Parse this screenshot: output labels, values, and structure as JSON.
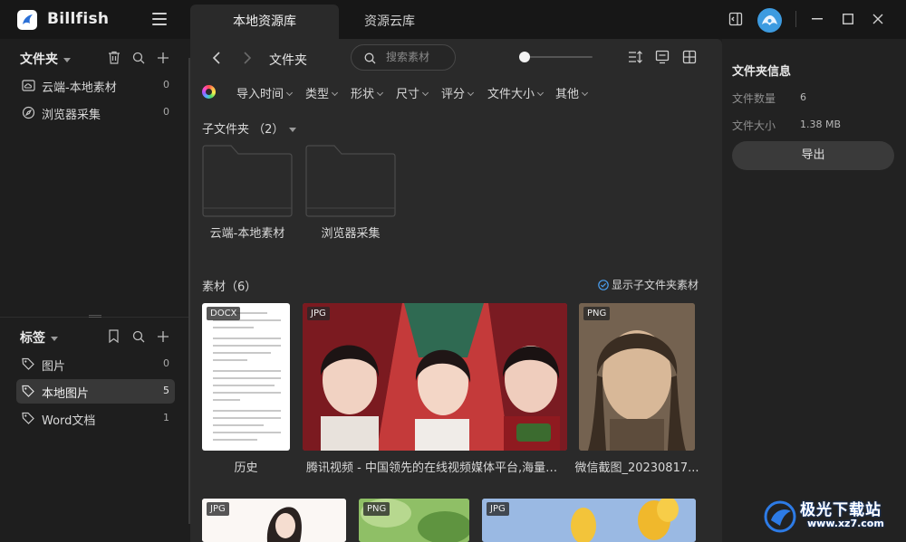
{
  "app": {
    "name": "Billfish"
  },
  "tabs": [
    {
      "label": "本地资源库",
      "active": true
    },
    {
      "label": "资源云库",
      "active": false
    }
  ],
  "sidebar": {
    "folders_title": "文件夹",
    "folders": [
      {
        "label": "云端-本地素材",
        "count": "0",
        "icon": "cloud-icon"
      },
      {
        "label": "浏览器采集",
        "count": "0",
        "icon": "compass-icon"
      }
    ],
    "tags_title": "标签",
    "tags": [
      {
        "label": "图片",
        "count": "0",
        "active": false
      },
      {
        "label": "本地图片",
        "count": "5",
        "active": true
      },
      {
        "label": "Word文档",
        "count": "1",
        "active": false
      }
    ]
  },
  "toolbar": {
    "crumb": "文件夹",
    "search_placeholder": "搜索素材",
    "thumb_size": 0.0
  },
  "filters": [
    "导入时间",
    "类型",
    "形状",
    "尺寸",
    "评分",
    "文件大小",
    "其他"
  ],
  "subfolders": {
    "title": "子文件夹 （2）",
    "items": [
      {
        "name": "云端-本地素材"
      },
      {
        "name": "浏览器采集"
      }
    ]
  },
  "assets": {
    "title": "素材（6）",
    "show_subfolder_label": "显示子文件夹素材",
    "items": [
      {
        "badge": "DOCX",
        "name": "历史"
      },
      {
        "badge": "JPG",
        "name": "腾讯视频 - 中国领先的在线视频媒体平台,海量高..."
      },
      {
        "badge": "PNG",
        "name": "微信截图_20230817..."
      },
      {
        "badge": "JPG",
        "name": ""
      },
      {
        "badge": "PNG",
        "name": ""
      },
      {
        "badge": "JPG",
        "name": ""
      }
    ]
  },
  "right_panel": {
    "title": "文件夹信息",
    "rows": [
      {
        "key": "文件数量",
        "value": "6"
      },
      {
        "key": "文件大小",
        "value": "1.38 MB"
      }
    ],
    "export_label": "导出"
  },
  "watermark": {
    "text": "极光下载站",
    "url": "www.xz7.com"
  },
  "colors": {
    "bg": "#1e1e1e",
    "main": "#2a2a2a",
    "accent": "#3d9be0"
  }
}
